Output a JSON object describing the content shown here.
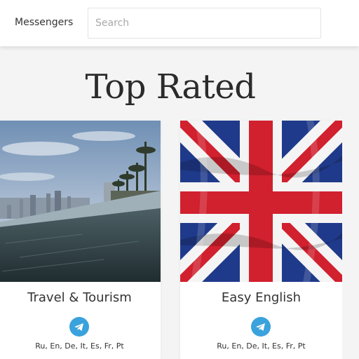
{
  "header": {
    "brand": "Messengers",
    "search_placeholder": "Search"
  },
  "heading": "Top Rated",
  "cards": [
    {
      "title": "Travel & Tourism",
      "icon": "telegram-icon",
      "languages": "Ru, En, De, It, Es, Fr, Pt"
    },
    {
      "title": "Easy English",
      "icon": "telegram-icon",
      "languages": "Ru, En, De, It, Es, Fr, Pt"
    }
  ],
  "colors": {
    "telegram": "#3aa2dc",
    "text": "#333333",
    "background": "#f4f4f4"
  }
}
